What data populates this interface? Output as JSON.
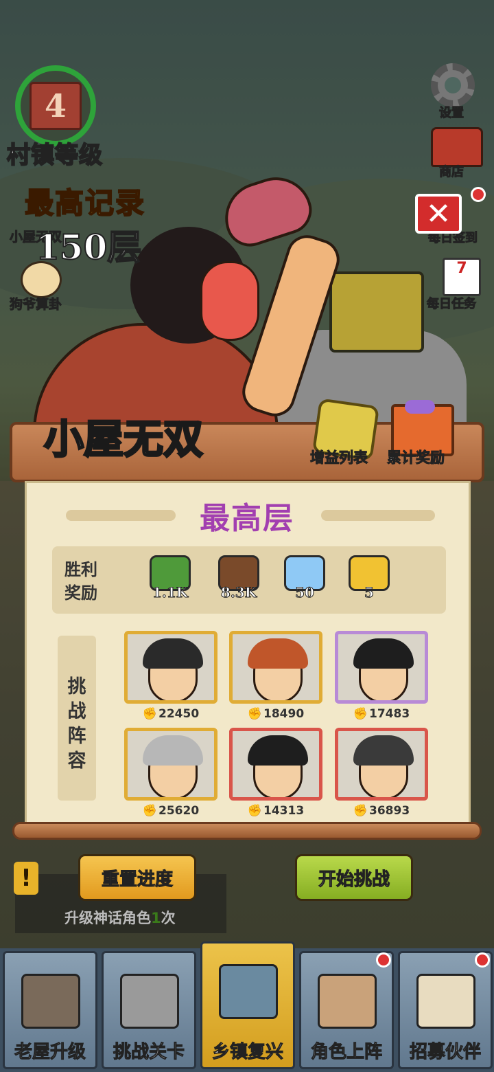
{
  "top_left": {
    "village_level": "4",
    "village_label": "村镇等级",
    "side_items": [
      "小屋无双",
      "狗爷算卦"
    ]
  },
  "top_right": {
    "settings": "设置",
    "shop": "商店",
    "daily_signin": "每日签到",
    "calendar_num": "7",
    "daily_task": "每日任务"
  },
  "record": {
    "title": "最高记录",
    "value": "150层"
  },
  "mode": {
    "title": "小屋无双",
    "bonus_list": "增益列表",
    "cumulative_rewards": "累计奖励"
  },
  "panel": {
    "title": "最高层",
    "reward_label": "胜利奖励",
    "rewards": [
      {
        "icon": "cash-stack-icon",
        "amount": "1.1K",
        "color": "#4f9a3a"
      },
      {
        "icon": "wood-log-icon",
        "amount": "8.3K",
        "color": "#7a4a2a"
      },
      {
        "icon": "diamond-icon",
        "amount": "50",
        "color": "#8fc9f5"
      },
      {
        "icon": "mystery-puzzle-icon",
        "amount": "5",
        "color": "#f1c232"
      }
    ],
    "lineup_label": "挑战阵容",
    "lineup": [
      {
        "power": "22450",
        "border": "#e0ac35",
        "hair": "#2a2a2a"
      },
      {
        "power": "18490",
        "border": "#e0ac35",
        "hair": "#c0562a"
      },
      {
        "power": "17483",
        "border": "#b88ad6",
        "hair": "#1e1e1e"
      },
      {
        "power": "25620",
        "border": "#e0ac35",
        "hair": "#b7b7b7"
      },
      {
        "power": "14313",
        "border": "#d9554a",
        "hair": "#1e1e1e"
      },
      {
        "power": "36893",
        "border": "#d9554a",
        "hair": "#3a3a3a"
      }
    ]
  },
  "buttons": {
    "reset": "重置进度",
    "start": "开始挑战"
  },
  "quest": {
    "text_prefix": "升级神话角色",
    "text_highlight": "1",
    "text_suffix": "次"
  },
  "nav": [
    {
      "label": "老屋升级",
      "icon": "house-icon",
      "active": false
    },
    {
      "label": "挑战关卡",
      "icon": "chainsaw-shovel-icon",
      "active": false
    },
    {
      "label": "乡镇复兴",
      "icon": "market-stall-icon",
      "active": true
    },
    {
      "label": "角色上阵",
      "icon": "characters-icon",
      "active": false
    },
    {
      "label": "招募伙伴",
      "icon": "recruit-poster-icon",
      "active": false
    }
  ]
}
